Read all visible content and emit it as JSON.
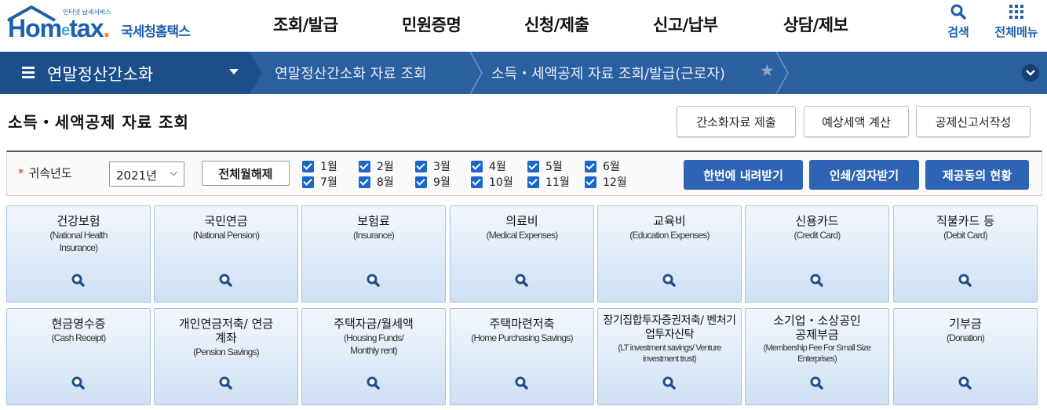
{
  "header": {
    "logo_small_text": "인터넷 납세서비스",
    "logo_brand": "Hometax.",
    "logo_korean": "국세청홈택스",
    "menu": [
      "조회/발급",
      "민원증명",
      "신청/제출",
      "신고/납부",
      "상담/제보"
    ],
    "search_label": "검색",
    "all_menu_label": "전체메뉴"
  },
  "nav": {
    "current": "연말정산간소화",
    "crumbs": [
      "연말정산간소화 자료 조회",
      "소득・세액공제 자료 조회/발급(근로자)"
    ]
  },
  "page": {
    "title": "소득・세액공제 자료 조회",
    "buttons": [
      "간소화자료 제출",
      "예상세액 계산",
      "공제신고서작성"
    ]
  },
  "filter": {
    "year_label": "귀속년도",
    "year_value": "2021년",
    "clear_label": "전체월해제",
    "months": [
      "1월",
      "2월",
      "3월",
      "4월",
      "5월",
      "6월",
      "7월",
      "8월",
      "9월",
      "10월",
      "11월",
      "12월"
    ],
    "actions": [
      "한번에 내려받기",
      "인쇄/점자받기",
      "제공동의 현황"
    ]
  },
  "cards": [
    {
      "title": "건강보험",
      "sub": "(National Health Insurance)"
    },
    {
      "title": "국민연금",
      "sub": "(National Pension)"
    },
    {
      "title": "보험료",
      "sub": "(Insurance)"
    },
    {
      "title": "의료비",
      "sub": "(Medical Expenses)"
    },
    {
      "title": "교육비",
      "sub": "(Education Expenses)"
    },
    {
      "title": "신용카드",
      "sub": "(Credit Card)"
    },
    {
      "title": "직불카드 등",
      "sub": "(Debit Card)"
    },
    {
      "title": "현금영수증",
      "sub": "(Cash Receipt)"
    },
    {
      "title": "개인연금저축/ 연금계좌",
      "sub": "(Pension Savings)"
    },
    {
      "title": "주택자금/월세액",
      "sub": "(Housing Funds/ Monthly rent)"
    },
    {
      "title": "주택마련저축",
      "sub": "(Home Purchasing Savings)"
    },
    {
      "title": "장기집합투자증권저축/ 벤처기업투자신탁",
      "sub": "(LT investment savings/ Venture investment trust)"
    },
    {
      "title": "소기업・소상공인 공제부금",
      "sub": "(Membership Fee For Small Size Enterprises)"
    },
    {
      "title": "기부금",
      "sub": "(Donation)"
    }
  ]
}
